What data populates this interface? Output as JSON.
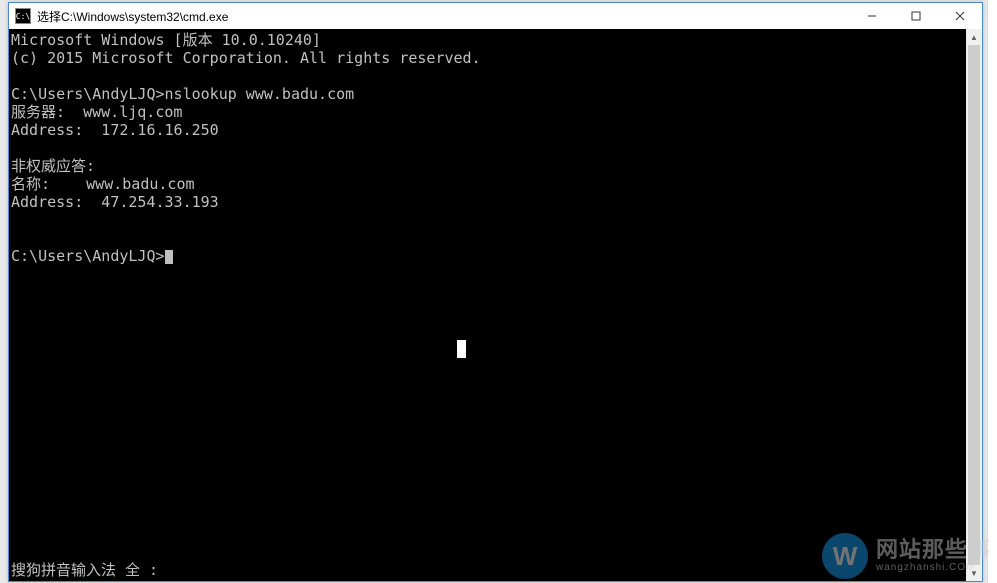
{
  "window": {
    "icon_text": "C:\\",
    "title": "选择C:\\Windows\\system32\\cmd.exe"
  },
  "controls": {
    "minimize": "—",
    "maximize": "□",
    "close": "×"
  },
  "scrollbar": {
    "up": "▲",
    "down": "▼"
  },
  "terminal": {
    "lines": [
      "Microsoft Windows [版本 10.0.10240]",
      "(c) 2015 Microsoft Corporation. All rights reserved.",
      "",
      "C:\\Users\\AndyLJQ>nslookup www.badu.com",
      "服务器:  www.ljq.com",
      "Address:  172.16.16.250",
      "",
      "非权威应答:",
      "名称:    www.badu.com",
      "Address:  47.254.33.193",
      "",
      "",
      "C:\\Users\\AndyLJQ>"
    ],
    "ime_line": "搜狗拼音输入法 全 :"
  },
  "watermark": {
    "badge": "W",
    "cn": "网站那些事",
    "en": "wangzhanshi.COM"
  }
}
